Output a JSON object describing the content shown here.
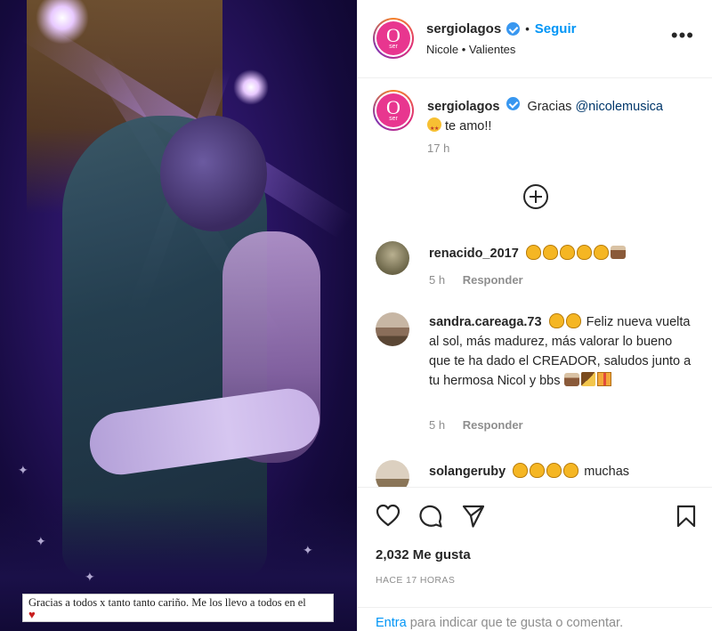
{
  "media": {
    "caption_text": "Gracias a todos x tanto tanto cariño. Me los llevo a todos en el",
    "caption_heart": "♥"
  },
  "header": {
    "avatar_logo_letter": "O",
    "avatar_logo_sub": "ser",
    "username": "sergiolagos",
    "separator": "•",
    "follow_label": "Seguir",
    "subtitle": "Nicole • Valientes",
    "more_label": "•••"
  },
  "caption": {
    "username": "sergiolagos",
    "text": "Gracias",
    "mention": "@nicolemusica",
    "text2": "te amo!!",
    "time": "17 h"
  },
  "comments": [
    {
      "username": "renacido_2017",
      "meta_time": "5 h",
      "reply_label": "Responder",
      "avatar_color": "#6b6548"
    },
    {
      "username": "sandra.careaga.73",
      "text": "Feliz nueva vuelta al sol, más madurez, más valorar lo bueno que te ha dado el CREADOR, saludos junto a tu hermosa Nicol y bbs",
      "meta_time": "5 h",
      "reply_label": "Responder",
      "avatar_color": "#8a6e5a"
    },
    {
      "username": "solangeruby",
      "text": "muchas",
      "avatar_color": "#b9a488"
    }
  ],
  "actions": {
    "likes": "2,032 Me gusta",
    "ago": "HACE 17 HORAS",
    "login_link": "Entra",
    "login_text": " para indicar que te gusta o comentar."
  },
  "colors": {
    "accent": "#0095f6",
    "verified": "#3897f0",
    "brand_pink": "#e8368f"
  }
}
